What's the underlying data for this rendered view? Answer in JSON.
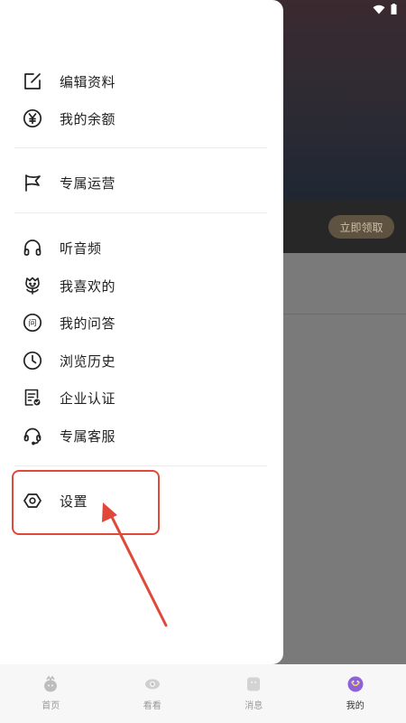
{
  "background": {
    "claim_button_label": "立即领取"
  },
  "drawer": {
    "group1": [
      {
        "label": "编辑资料",
        "icon": "edit-icon"
      },
      {
        "label": "我的余额",
        "icon": "yen-icon"
      }
    ],
    "group2": [
      {
        "label": "专属运营",
        "icon": "flag-icon"
      }
    ],
    "group3": [
      {
        "label": "听音频",
        "icon": "headphones-icon"
      },
      {
        "label": "我喜欢的",
        "icon": "flower-icon"
      },
      {
        "label": "我的问答",
        "icon": "qa-icon"
      },
      {
        "label": "浏览历史",
        "icon": "clock-icon"
      },
      {
        "label": "企业认证",
        "icon": "certificate-icon"
      },
      {
        "label": "专属客服",
        "icon": "headset-icon"
      }
    ],
    "group4": [
      {
        "label": "设置",
        "icon": "settings-icon"
      }
    ]
  },
  "bottom_nav": [
    {
      "label": "首页",
      "icon": "home-icon",
      "active": false
    },
    {
      "label": "看看",
      "icon": "eye-icon",
      "active": false
    },
    {
      "label": "消息",
      "icon": "message-icon",
      "active": false
    },
    {
      "label": "我的",
      "icon": "profile-icon",
      "active": true
    }
  ],
  "colors": {
    "annotation": "#e0483a",
    "active_nav_icon": "#8f63d8"
  }
}
